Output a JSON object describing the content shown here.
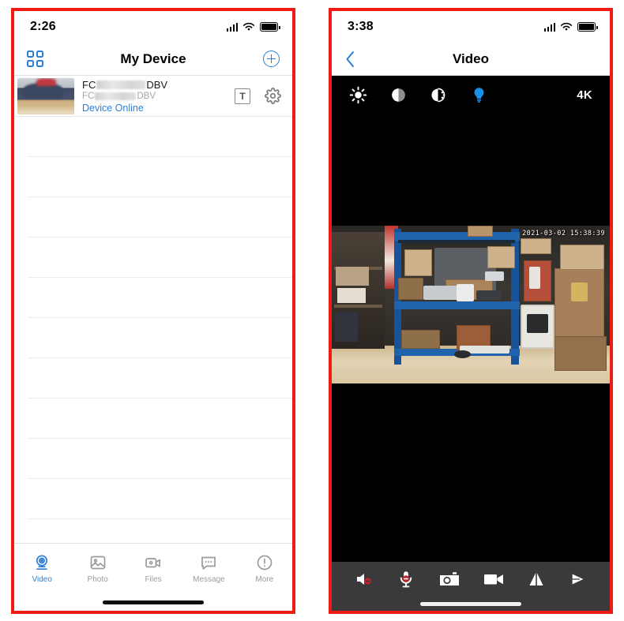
{
  "left_phone": {
    "status_bar": {
      "time": "2:26",
      "signal_icon": "cellular-signal-icon",
      "wifi_icon": "wifi-icon",
      "battery_icon": "battery-full-icon"
    },
    "navbar": {
      "grid_icon": "grid-view-icon",
      "title": "My Device",
      "add_icon": "add-circle-icon"
    },
    "device_row": {
      "thumbnail": "device-snapshot-thumbnail",
      "name_prefix": "FC",
      "name_suffix": "DBV",
      "sub_prefix": "FC",
      "sub_suffix": "DBV",
      "status": "Device Online",
      "text_button": "T",
      "settings_icon": "gear-icon"
    },
    "empty_rows": 11,
    "tabs": [
      {
        "label": "Video",
        "icon": "webcam-icon",
        "active": true
      },
      {
        "label": "Photo",
        "icon": "photo-icon",
        "active": false
      },
      {
        "label": "Files",
        "icon": "video-file-icon",
        "active": false
      },
      {
        "label": "Message",
        "icon": "message-icon",
        "active": false
      },
      {
        "label": "More",
        "icon": "more-info-icon",
        "active": false
      }
    ],
    "accent_color": "#2b7fd4",
    "frame_color": "#ef1c16"
  },
  "right_phone": {
    "status_bar": {
      "time": "3:38",
      "signal_icon": "cellular-signal-icon",
      "wifi_icon": "wifi-icon",
      "battery_icon": "battery-full-icon"
    },
    "navbar": {
      "back_icon": "back-chevron-icon",
      "title": "Video"
    },
    "video_tools": [
      {
        "icon": "brightness-sun-icon"
      },
      {
        "icon": "contrast-icon"
      },
      {
        "icon": "saturation-icon"
      },
      {
        "icon": "lightbulb-icon",
        "active": true
      }
    ],
    "resolution_label": "4K",
    "feed": {
      "timestamp": "2021-03-02 15:38:39",
      "scene": "warehouse-shelving-live-feed"
    },
    "bottom_toolbar": [
      {
        "icon": "speaker-muted-icon"
      },
      {
        "icon": "microphone-muted-icon"
      },
      {
        "icon": "snapshot-camera-icon"
      },
      {
        "icon": "record-video-icon"
      },
      {
        "icon": "mirror-flip-icon"
      },
      {
        "icon": "playback-arrow-icon"
      }
    ],
    "accent_color": "#2b7fd4",
    "toolbar_bg": "#3a3a3a",
    "frame_color": "#ef1c16"
  }
}
